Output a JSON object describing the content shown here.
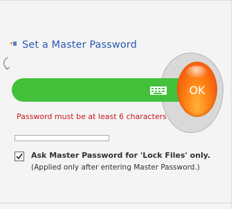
{
  "dialog": {
    "title": "Set a Master Password",
    "ok_label": "OK",
    "error_message": "Password must be at least 6 characters",
    "password_value": "",
    "strength_level": 0,
    "lock_files_option": {
      "label": "Ask Master Password for 'Lock Files' only.",
      "note": "(Applied only after entering Master Password.)",
      "checked": true
    }
  },
  "icons": {
    "lock": "lock-icon",
    "back_arrow": "back-arrow-icon",
    "keyboard": "virtual-keyboard-icon",
    "checkmark": "checkmark-icon"
  },
  "colors": {
    "title": "#2b59b0",
    "password_field": "#43c13b",
    "ok_button": "#f86210",
    "error": "#c8161e"
  }
}
